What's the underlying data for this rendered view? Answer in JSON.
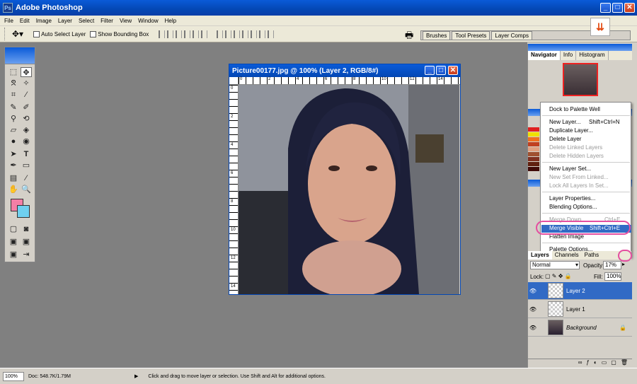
{
  "app": {
    "title": "Adobe Photoshop",
    "min": "_",
    "max": "□",
    "close": "✕"
  },
  "menu": [
    "File",
    "Edit",
    "Image",
    "Layer",
    "Select",
    "Filter",
    "View",
    "Window",
    "Help"
  ],
  "options": {
    "auto_select": "Auto Select Layer",
    "bounding_box": "Show Bounding Box"
  },
  "palette_well": {
    "tabs": [
      "Brushes",
      "Tool Presets",
      "Layer Comps"
    ]
  },
  "document": {
    "title": "Picture00177.jpg @ 100% (Layer 2, RGB/8#)",
    "min": "_",
    "max": "□",
    "close": "✕",
    "ruler_h": [
      "0",
      "1",
      "2",
      "3",
      "4",
      "5",
      "6",
      "7",
      "8",
      "9",
      "10",
      "11",
      "12",
      "13",
      "14",
      "15"
    ],
    "ruler_v": [
      "0",
      "2",
      "4",
      "6",
      "8",
      "10",
      "12",
      "14"
    ]
  },
  "navigator": {
    "tabs": [
      "Navigator",
      "Info",
      "Histogram"
    ]
  },
  "context_menu": {
    "items": [
      {
        "label": "Dock to Palette Well",
        "shortcut": "",
        "disabled": false
      },
      {
        "label": "New Layer...",
        "shortcut": "Shift+Ctrl+N",
        "disabled": false
      },
      {
        "label": "Duplicate Layer...",
        "shortcut": "",
        "disabled": false
      },
      {
        "label": "Delete Layer",
        "shortcut": "",
        "disabled": false
      },
      {
        "label": "Delete Linked Layers",
        "shortcut": "",
        "disabled": true
      },
      {
        "label": "Delete Hidden Layers",
        "shortcut": "",
        "disabled": true
      },
      {
        "label": "New Layer Set...",
        "shortcut": "",
        "disabled": false
      },
      {
        "label": "New Set From Linked...",
        "shortcut": "",
        "disabled": true
      },
      {
        "label": "Lock All Layers In Set...",
        "shortcut": "",
        "disabled": true
      },
      {
        "label": "Layer Properties...",
        "shortcut": "",
        "disabled": false
      },
      {
        "label": "Blending Options...",
        "shortcut": "",
        "disabled": false
      },
      {
        "label": "Merge Down",
        "shortcut": "Ctrl+E",
        "disabled": true
      },
      {
        "label": "Merge Visible",
        "shortcut": "Shift+Ctrl+E",
        "disabled": false,
        "selected": true
      },
      {
        "label": "Flatten Image",
        "shortcut": "",
        "disabled": false
      },
      {
        "label": "Palette Options...",
        "shortcut": "",
        "disabled": false
      }
    ]
  },
  "layers_panel": {
    "tabs": [
      "Layers",
      "Channels",
      "Paths"
    ],
    "blend_mode": "Normal",
    "opacity_label": "Opacity:",
    "opacity": "17%",
    "lock_label": "Lock:",
    "fill_label": "Fill:",
    "fill": "100%",
    "layers": [
      {
        "name": "Layer 2",
        "selected": true
      },
      {
        "name": "Layer 1",
        "selected": false
      },
      {
        "name": "Background",
        "selected": false
      }
    ]
  },
  "status": {
    "zoom": "100%",
    "doc": "Doc: 548.7K/1.79M",
    "message": "Click and drag to move layer or selection.  Use Shift and Alt for additional options."
  },
  "colors": {
    "foreground": "#f47fa6",
    "background": "#6fd0ef",
    "highlight": "#316ac5",
    "annotation": "#e44fa0"
  }
}
